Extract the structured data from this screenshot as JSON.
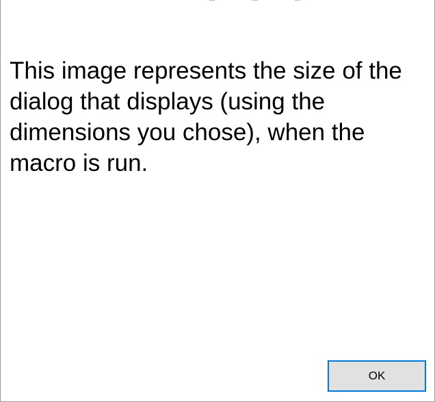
{
  "dialog": {
    "message": "This image represents the size of the dialog that displays (using the dimensions you chose), when the macro is run.",
    "ok_label": "OK",
    "accent_color": "#0078d7",
    "button_face_color": "#e1e1e1"
  }
}
